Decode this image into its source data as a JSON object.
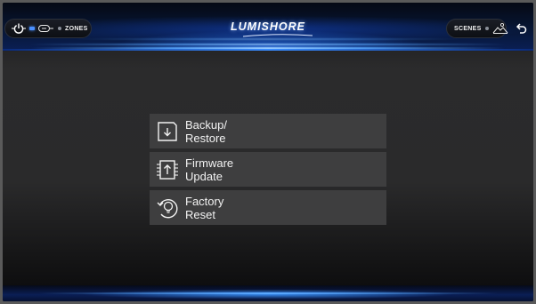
{
  "header": {
    "brand": "LUMISHORE",
    "zones_label": "ZONES",
    "scenes_label": "SCENES"
  },
  "icons": {
    "power": "power-icon",
    "zones": "zone-light-icon",
    "scenes": "scenes-mountain-icon",
    "back": "back-arrow-icon",
    "backup": "floppy-download-icon",
    "firmware": "chip-upload-icon",
    "factory": "reset-bulb-icon"
  },
  "colors": {
    "accent": "#3a8cff",
    "menu_bg": "#3e3e3f",
    "text": "#f2f2f2"
  },
  "menu": {
    "items": [
      {
        "label": "Backup/\nRestore"
      },
      {
        "label": "Firmware\nUpdate"
      },
      {
        "label": "Factory\nReset"
      }
    ]
  }
}
